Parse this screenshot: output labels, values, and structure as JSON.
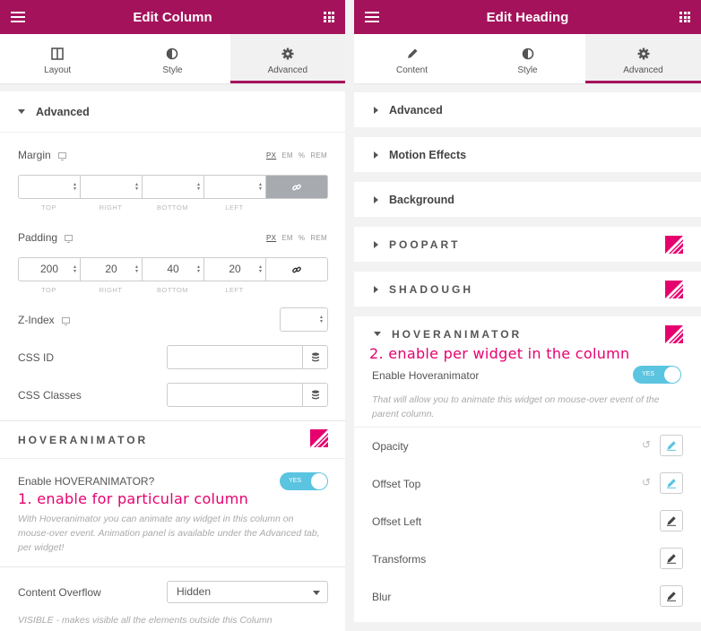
{
  "left": {
    "header_title": "Edit Column",
    "tabs": [
      {
        "label": "Layout",
        "icon": "layout-icon"
      },
      {
        "label": "Style",
        "icon": "half-circle-icon"
      },
      {
        "label": "Advanced",
        "icon": "gear-icon",
        "active": true
      }
    ],
    "section_title": "Advanced",
    "margin": {
      "label": "Margin",
      "units": [
        "PX",
        "EM",
        "%",
        "REM"
      ],
      "values": [
        "",
        "",
        "",
        ""
      ],
      "sides": [
        "TOP",
        "RIGHT",
        "BOTTOM",
        "LEFT"
      ],
      "linked": true
    },
    "padding": {
      "label": "Padding",
      "units": [
        "PX",
        "EM",
        "%",
        "REM"
      ],
      "values": [
        "200",
        "20",
        "40",
        "20"
      ],
      "sides": [
        "TOP",
        "RIGHT",
        "BOTTOM",
        "LEFT"
      ],
      "linked": false
    },
    "zindex_label": "Z-Index",
    "css_id_label": "CSS ID",
    "css_classes_label": "CSS Classes",
    "hoveranimator_title": "HOVERANIMATOR",
    "enable_label": "Enable HOVERANIMATOR?",
    "toggle_text": "YES",
    "annotation": "1. enable for particular column",
    "description": "With Hoveranimator you can animate any widget in this column on mouse-over event. Animation panel is available under the Advanced tab, per widget!",
    "content_overflow_label": "Content Overflow",
    "content_overflow_value": "Hidden",
    "overflow_desc": "VISIBLE - makes visible all the elements outside this Column"
  },
  "right": {
    "header_title": "Edit Heading",
    "tabs": [
      {
        "label": "Content",
        "icon": "pencil-icon"
      },
      {
        "label": "Style",
        "icon": "half-circle-icon"
      },
      {
        "label": "Advanced",
        "icon": "gear-icon",
        "active": true
      }
    ],
    "sections": [
      "Advanced",
      "Motion Effects",
      "Background",
      "POOPART",
      "SHADOUGH",
      "HOVERANIMATOR"
    ],
    "annotation": "2. enable per widget in the column",
    "enable_label": "Enable Hoveranimator",
    "toggle_text": "YES",
    "description": "That will allow you to animate this widget on mouse-over event of the parent column.",
    "controls": [
      "Opacity",
      "Offset Top",
      "Offset Left",
      "Transforms",
      "Blur"
    ]
  },
  "colors": {
    "brand": "#a4125b",
    "accent": "#e6006e",
    "toggle": "#5bc4e0"
  }
}
